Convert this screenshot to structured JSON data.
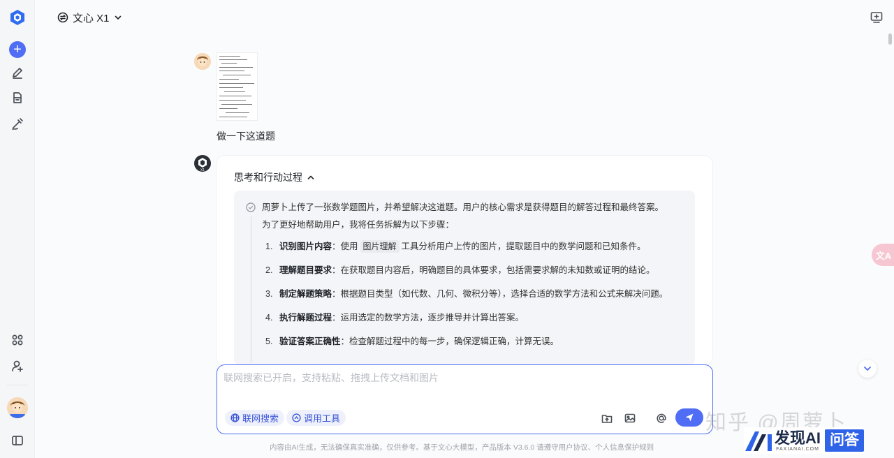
{
  "header": {
    "model_name": "文心 X1"
  },
  "colors": {
    "accent": "#4f6df5",
    "send_button": "#4f6df5",
    "think_background": "#f4f5f8"
  },
  "sidebar": {
    "icons": [
      "logo-icon",
      "new-chat-icon",
      "edit-icon",
      "document-icon",
      "draw-icon",
      "apps-grid-icon",
      "add-user-icon",
      "avatar",
      "sidebar-toggle-icon"
    ]
  },
  "conversation": {
    "user_message": "做一下这道题",
    "thinking": {
      "header": "思考和行动过程",
      "intro_1": "周萝卜上传了一张数学题图片，并希望解决这道题。用户的核心需求是获得题目的解答过程和最终答案。",
      "intro_2": "为了更好地帮助用户，我将任务拆解为以下步骤：",
      "steps": [
        {
          "num": "1.",
          "title": "识别图片内容",
          "pre": "：使用",
          "tool": "图片理解",
          "text": "工具分析用户上传的图片，提取题目中的数学问题和已知条件。"
        },
        {
          "num": "2.",
          "title": "理解题目要求",
          "pre": "",
          "tool": "",
          "text": "：在获取题目内容后，明确题目的具体要求，包括需要求解的未知数或证明的结论。"
        },
        {
          "num": "3.",
          "title": "制定解题策略",
          "pre": "",
          "tool": "",
          "text": "：根据题目类型（如代数、几何、微积分等），选择合适的数学方法和公式来解决问题。"
        },
        {
          "num": "4.",
          "title": "执行解题过程",
          "pre": "",
          "tool": "",
          "text": "：运用选定的数学方法，逐步推导并计算出答案。"
        },
        {
          "num": "5.",
          "title": "验证答案正确性",
          "pre": "",
          "tool": "",
          "text": "：检查解题过程中的每一步，确保逻辑正确，计算无误。"
        }
      ]
    }
  },
  "input": {
    "placeholder": "联网搜索已开启，支持粘贴、拖拽上传文档和图片",
    "value": "",
    "web_search_label": "联网搜索",
    "tools_label": "调用工具"
  },
  "floating": {
    "translate_label": "文A"
  },
  "footer": {
    "disclaimer": "内容由AI生成，无法确保真实准确，仅供参考。基于文心大模型，产品版本 V3.6.0 请遵守用户协议、个人信息保护规则"
  },
  "watermark": {
    "zhihu": "知乎 @周萝卜",
    "brand": "发现AI",
    "brand_sub": "FAXIANAI.COM",
    "qa": "问答"
  }
}
